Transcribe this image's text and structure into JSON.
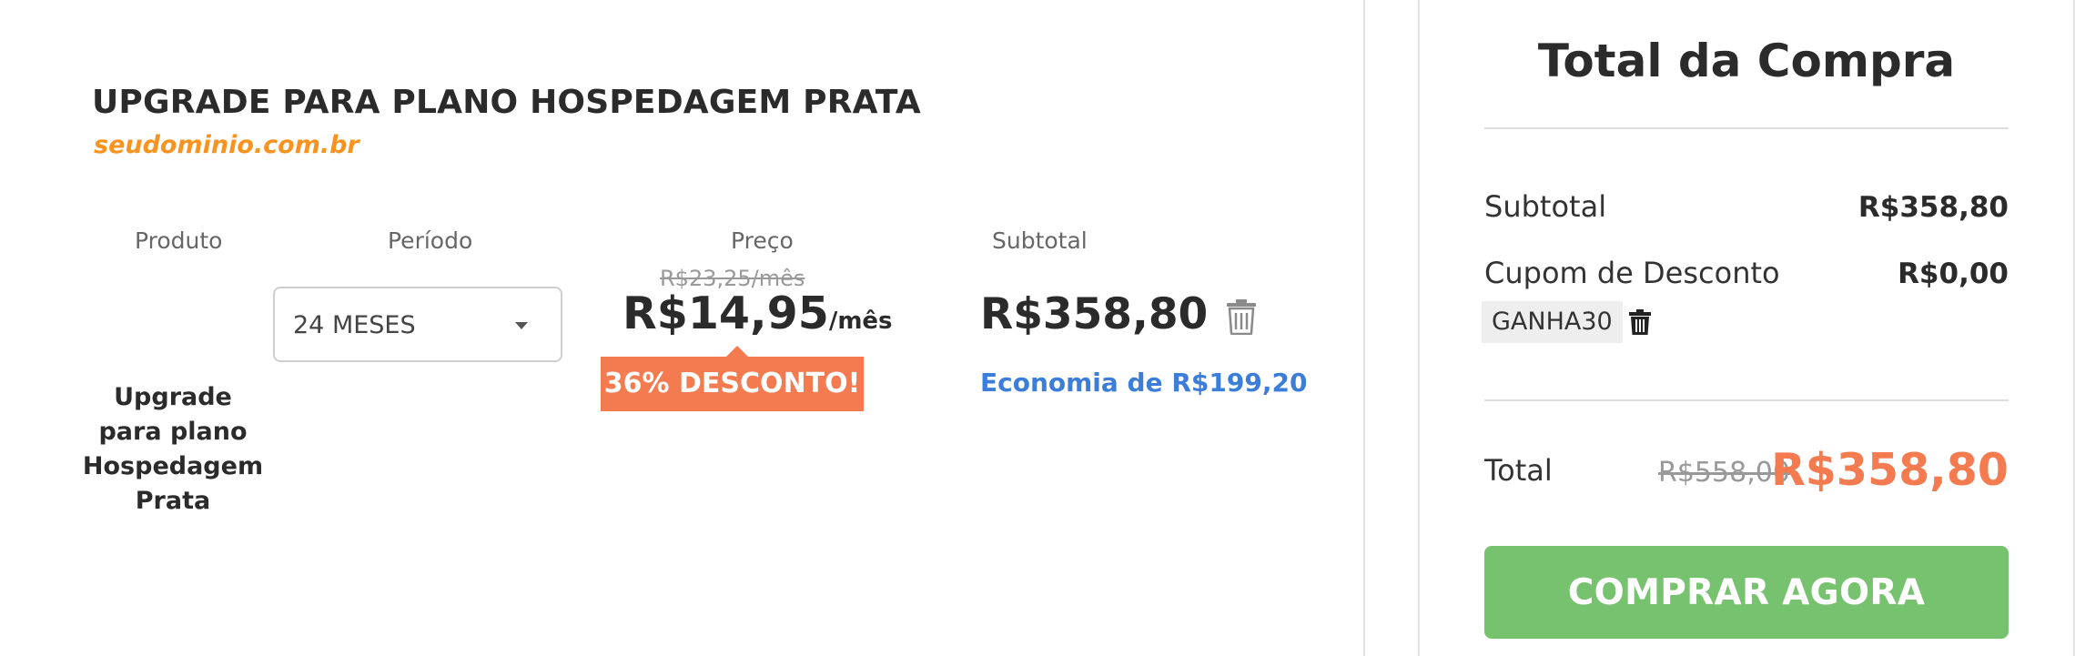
{
  "header": {
    "title": "UPGRADE PARA PLANO HOSPEDAGEM PRATA",
    "domain": "seudominio.com.br"
  },
  "table": {
    "columns": [
      "Produto",
      "Período",
      "Preço",
      "Subtotal"
    ],
    "product_name": "Upgrade para plano Hospedagem Prata",
    "period_selected": "24 MESES",
    "price_old": "R$23,25/mês",
    "price_new": "R$14,95",
    "price_unit": "/mês",
    "discount_badge": "36% DESCONTO!",
    "subtotal": "R$358,80",
    "saving": "Economia de R$199,20"
  },
  "summary": {
    "title": "Total da Compra",
    "subtotal_label": "Subtotal",
    "subtotal_value": "R$358,80",
    "coupon_label": "Cupom de Desconto",
    "coupon_value": "R$0,00",
    "coupon_code": "GANHA30",
    "total_label": "Total",
    "total_old": "R$558,00",
    "total_new": "R$358,80",
    "buy_button": "COMPRAR AGORA"
  },
  "icons": {
    "remove_item": "trash-icon",
    "remove_coupon": "trash-icon",
    "period_dropdown": "caret-down-icon"
  },
  "colors": {
    "accent_orange": "#f47b50",
    "domain_orange": "#f7931e",
    "saving_blue": "#3b7dd8",
    "buy_green": "#76c26e"
  }
}
